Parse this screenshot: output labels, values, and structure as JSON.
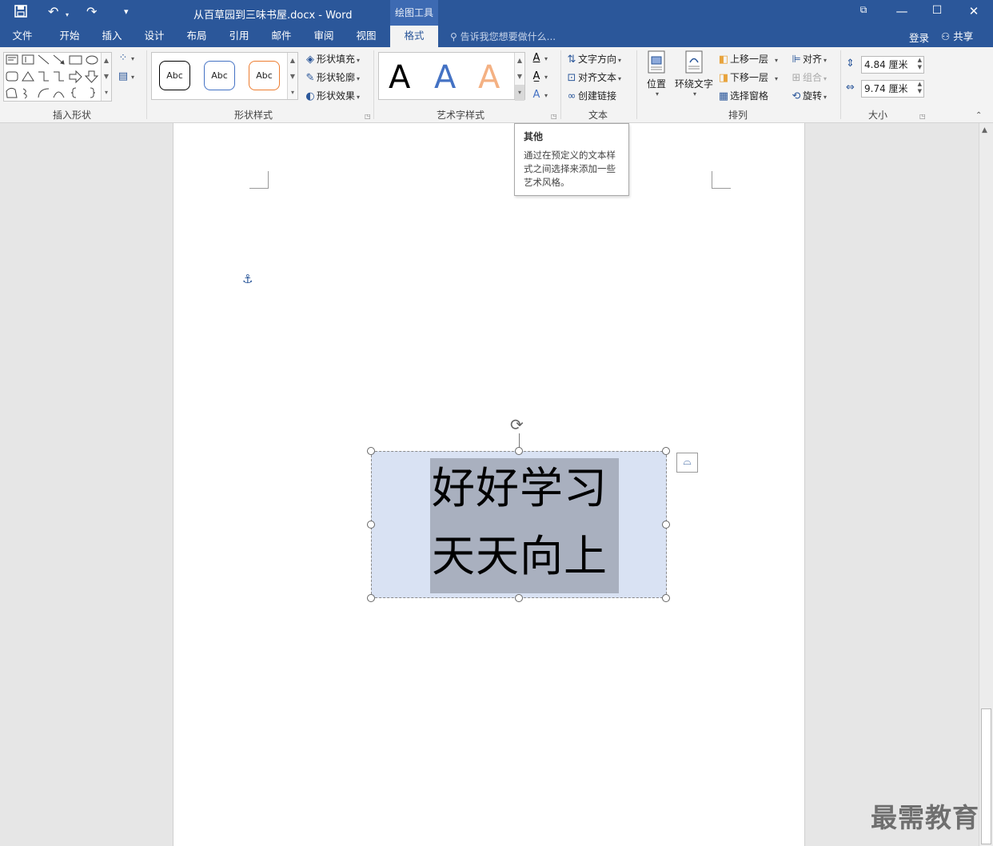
{
  "titlebar": {
    "title": "从百草园到三味书屋.docx - Word",
    "context_tab": "绘图工具",
    "save_icon": "save-icon",
    "undo_glyph": "↶",
    "redo_glyph": "↷",
    "qa_more_glyph": "⩡"
  },
  "tabs": {
    "file": "文件",
    "home": "开始",
    "insert": "插入",
    "design": "设计",
    "layout": "布局",
    "references": "引用",
    "mailings": "邮件",
    "review": "审阅",
    "view": "视图",
    "format": "格式"
  },
  "tell_me": "告诉我您想要做什么...",
  "login": "登录",
  "share": "共享",
  "groups": {
    "insert_shapes": "插入形状",
    "shape_styles": "形状样式",
    "wordart_styles": "艺术字样式",
    "text": "文本",
    "arrange": "排列",
    "size": "大小"
  },
  "shape_styles": {
    "abc": "Abc",
    "fill": "形状填充",
    "outline": "形状轮廓",
    "effects": "形状效果"
  },
  "wordart": {
    "letter": "A"
  },
  "text_group": {
    "direction": "文字方向",
    "align": "对齐文本",
    "link": "创建链接"
  },
  "arrange": {
    "position": "位置",
    "wrap": "环绕文字",
    "forward": "上移一层",
    "backward": "下移一层",
    "selection_pane": "选择窗格",
    "align": "对齐",
    "group": "组合",
    "rotate": "旋转"
  },
  "size": {
    "height": "4.84 厘米",
    "width": "9.74 厘米"
  },
  "tooltip": {
    "title": "其他",
    "body": "通过在预定义的文本样式之间选择来添加一些艺术风格。"
  },
  "document": {
    "line1": "好好学习",
    "line2": "天天向上"
  },
  "watermark": "最需教育",
  "colors": {
    "brand": "#2b579a",
    "shape_fill": "#d9e2f3",
    "highlight": "#a9b0bf",
    "annotation_red": "#e53935"
  }
}
